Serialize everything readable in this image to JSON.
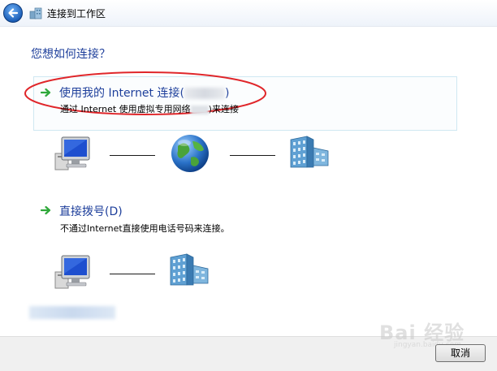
{
  "window": {
    "title": "连接到工作区"
  },
  "question": "您想如何连接？",
  "options": [
    {
      "title_prefix": "使用我的 Internet 连接(",
      "title_suffix": ")",
      "desc_prefix": "通过 Internet 使用虚拟专用网络",
      "desc_suffix": ")来连接"
    },
    {
      "title": "直接拨号(D)",
      "desc": "不通过Internet直接使用电话号码来连接。"
    }
  ],
  "footer": {
    "cancel_label": "取消"
  },
  "watermark": {
    "text": "Bai 经验",
    "sub": "jingyan.baidu.com"
  },
  "icons": [
    "back-arrow",
    "workplace-icon",
    "computer-icon",
    "globe-icon",
    "office-building-icon",
    "green-arrow-icon"
  ],
  "colors": {
    "heading_blue": "#1e3f9b",
    "highlight_red": "#e0262a",
    "arrow_green": "#2fa83a"
  }
}
